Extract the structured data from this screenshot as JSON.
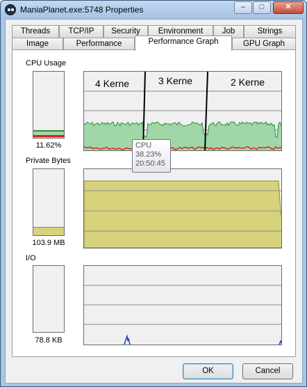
{
  "window": {
    "title": "ManiaPlanet.exe:5748 Properties",
    "minimize_glyph": "–",
    "maximize_glyph": "□",
    "close_glyph": "✕"
  },
  "tabs": {
    "row1": [
      "Threads",
      "TCP/IP",
      "Security",
      "Environment",
      "Job",
      "Strings"
    ],
    "row2": [
      "Image",
      "Performance",
      "Performance Graph",
      "GPU Graph"
    ],
    "active": "Performance Graph"
  },
  "cpu": {
    "label": "CPU Usage",
    "value": "11.62%",
    "meter_fraction": 0.1162,
    "annotations": [
      "4 Kerne",
      "3 Kerne",
      "2 Kerne"
    ]
  },
  "tooltip": {
    "title": "CPU",
    "value": "38.23%",
    "time": "20:50:45"
  },
  "private_bytes": {
    "label": "Private Bytes",
    "value": "103.9 MB",
    "meter_fraction": 0.13
  },
  "io": {
    "label": "I/O",
    "value": "78.8  KB"
  },
  "buttons": {
    "ok": "OK",
    "cancel": "Cancel"
  },
  "colors": {
    "cpu_fill": "#a0d6a8",
    "cpu_line": "#2e8b3a",
    "kernel_line": "#e02020",
    "bytes_fill": "#d6d37c",
    "io_line": "#1a3fd0",
    "grid": "#8a8a8a",
    "window_frame": "#a9c5e4"
  }
}
